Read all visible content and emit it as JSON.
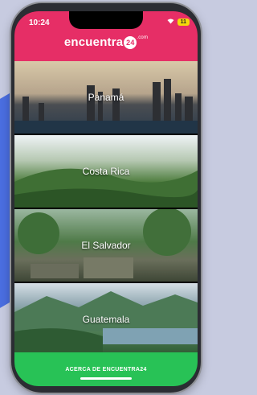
{
  "statusbar": {
    "time": "10:24",
    "battery": "11"
  },
  "header": {
    "logo_text": "encuentra",
    "logo_badge": "24",
    "logo_suffix": ".com",
    "color": "#e62e66"
  },
  "countries": [
    {
      "name": "Panamá"
    },
    {
      "name": "Costa Rica"
    },
    {
      "name": "El Salvador"
    },
    {
      "name": "Guatemala"
    }
  ],
  "footer": {
    "cta_label": "ACERCA DE ENCUENTRA24",
    "color": "#28c256"
  }
}
